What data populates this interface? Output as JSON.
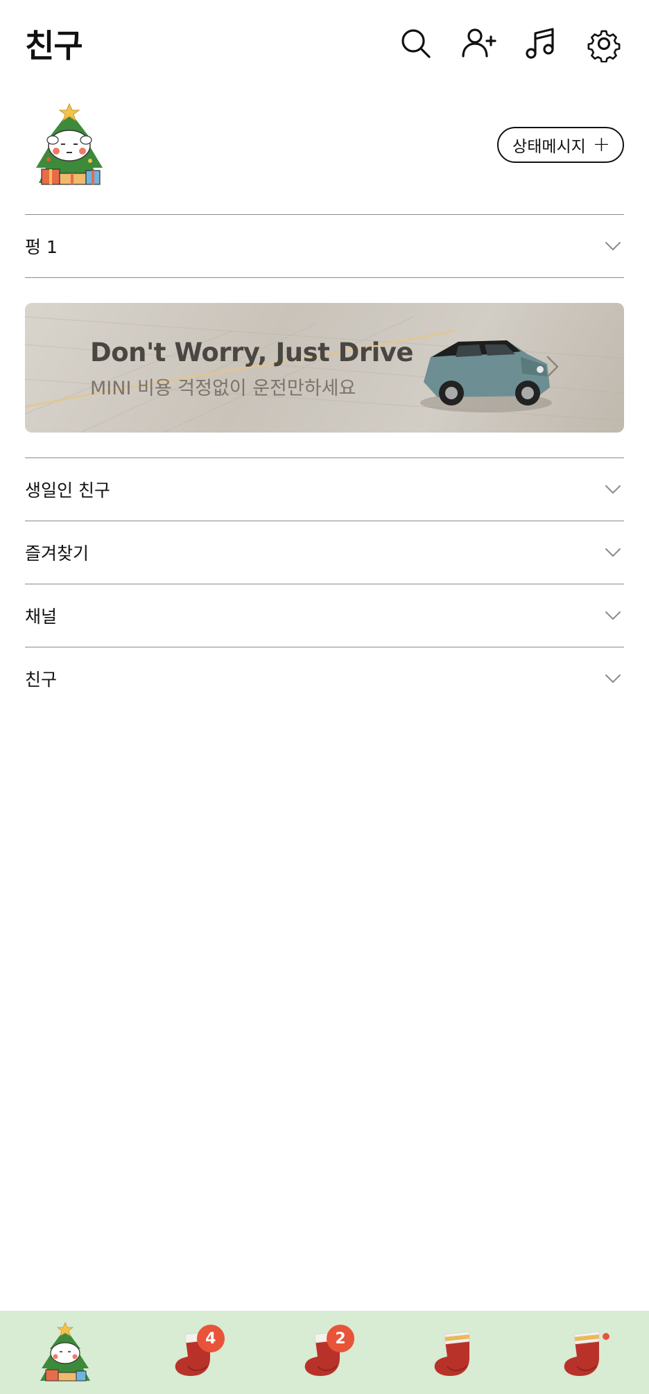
{
  "header": {
    "title": "친구",
    "icons": [
      "search-icon",
      "add-friend-icon",
      "music-icon",
      "settings-icon"
    ]
  },
  "profile": {
    "status_button_label": "상태메시지",
    "status_button_plus": "+"
  },
  "sections": [
    {
      "label": "펑 1"
    },
    {
      "label": "생일인 친구"
    },
    {
      "label": "즐겨찾기"
    },
    {
      "label": "채널"
    },
    {
      "label": "친구"
    }
  ],
  "ad": {
    "title": "Don't Worry, Just Drive",
    "subtitle": "MINI 비용 걱정없이 운전만하세요"
  },
  "bottom_nav": {
    "items": [
      {
        "name": "profile-tab",
        "icon": "tree-avatar-icon"
      },
      {
        "name": "chat-tab",
        "icon": "stocking-icon",
        "badge": "4"
      },
      {
        "name": "openchat-tab",
        "icon": "stocking-icon",
        "badge": "2"
      },
      {
        "name": "shopping-tab",
        "icon": "stocking-icon"
      },
      {
        "name": "more-tab",
        "icon": "stocking-icon",
        "dot": true
      }
    ]
  },
  "colors": {
    "nav_background": "#d8ebd3",
    "badge": "#e8543a",
    "divider": "#8a8a8a"
  }
}
